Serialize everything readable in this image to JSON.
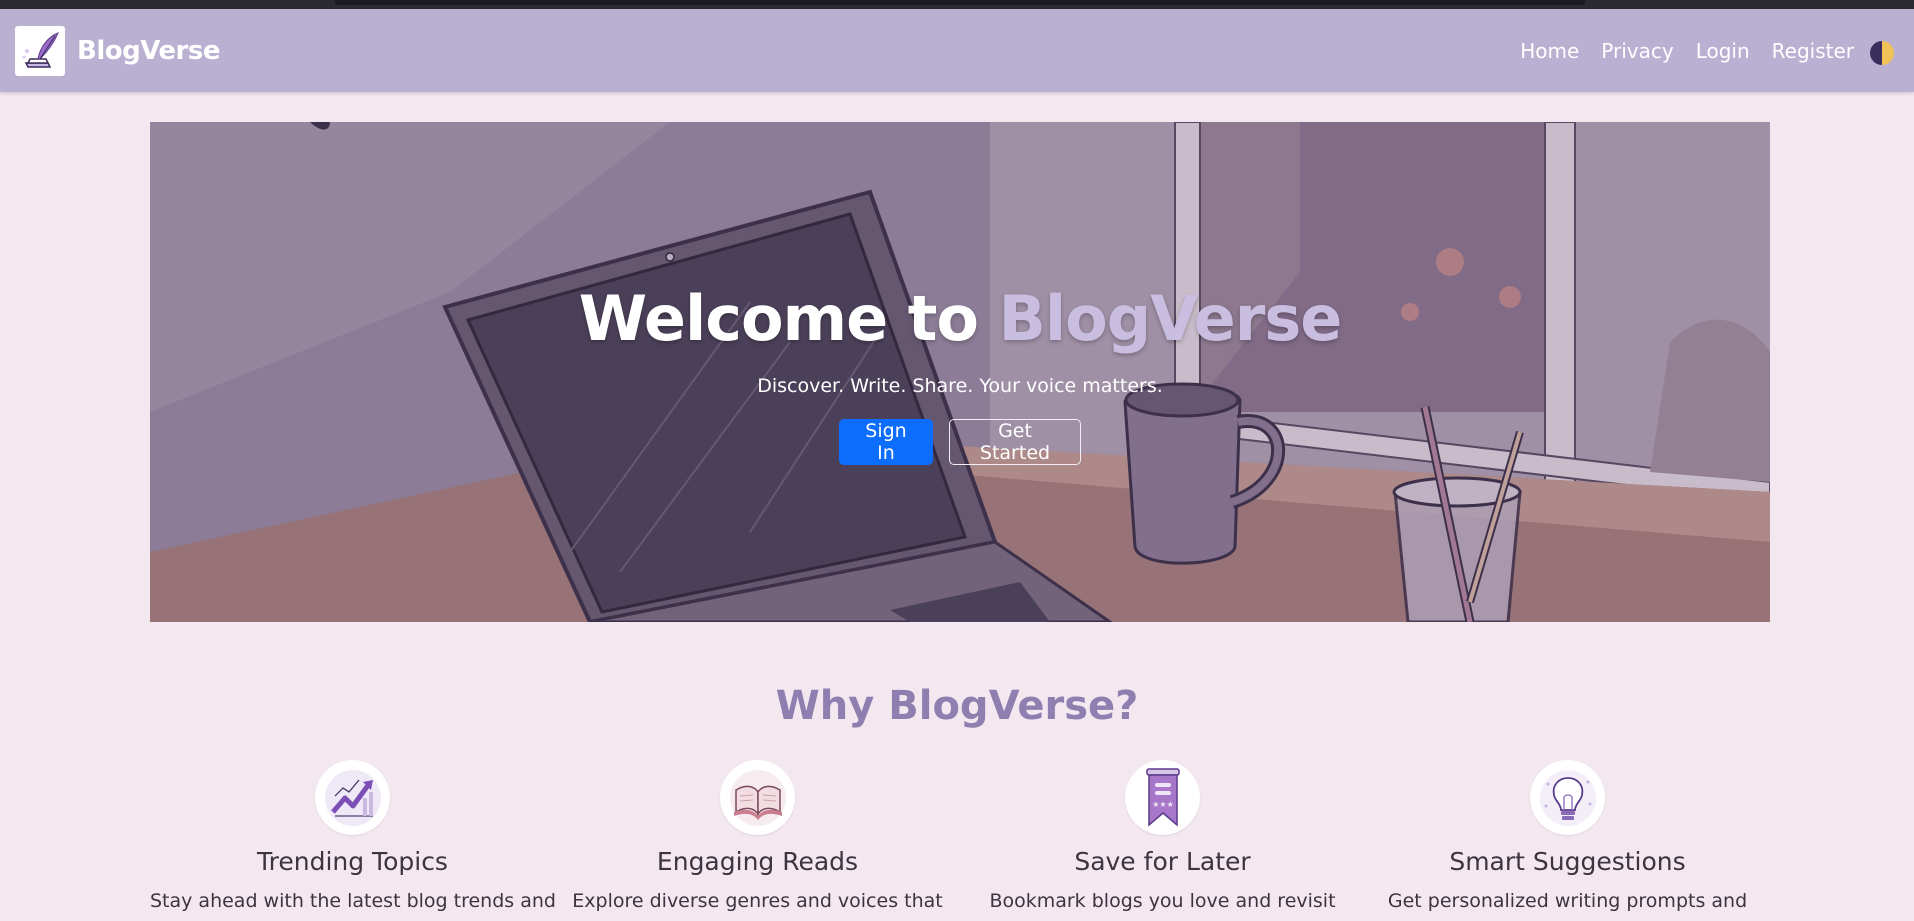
{
  "app": {
    "brand_name": "BlogVerse",
    "logo_icon": "quill-book-icon"
  },
  "nav": {
    "items": [
      {
        "label": "Home"
      },
      {
        "label": "Privacy"
      },
      {
        "label": "Login"
      },
      {
        "label": "Register"
      }
    ],
    "theme_toggle_icon": "half-moon-toggle-icon"
  },
  "hero": {
    "title_prefix": "Welcome to",
    "title_accent": "BlogVerse",
    "subtitle": "Discover. Write. Share. Your voice matters.",
    "primary_button": "Sign In",
    "secondary_button": "Get Started"
  },
  "why": {
    "title": "Why BlogVerse?",
    "features": [
      {
        "icon": "trending-chart-icon",
        "title": "Trending Topics",
        "desc": "Stay ahead with the latest blog trends and"
      },
      {
        "icon": "open-book-icon",
        "title": "Engaging Reads",
        "desc": "Explore diverse genres and voices that"
      },
      {
        "icon": "bookmark-ribbon-icon",
        "title": "Save for Later",
        "desc": "Bookmark blogs you love and revisit"
      },
      {
        "icon": "lightbulb-icon",
        "title": "Smart Suggestions",
        "desc": "Get personalized writing prompts and"
      }
    ]
  },
  "colors": {
    "navbar": "#b9b0d2",
    "page_background": "#f4e8f0",
    "accent_text": "#c9bde0",
    "primary_button": "#0d6efd",
    "section_title": "#8e7fb0"
  }
}
